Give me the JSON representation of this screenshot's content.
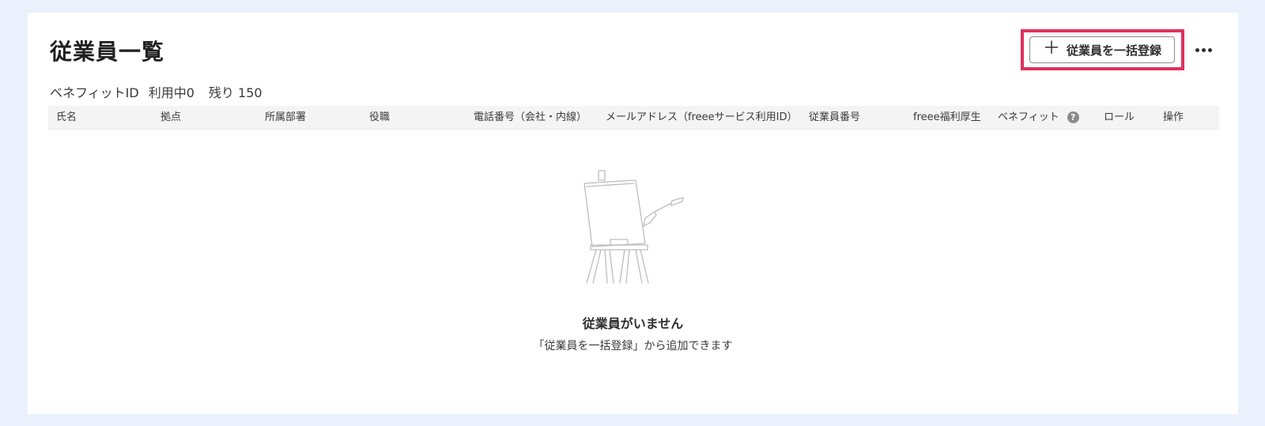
{
  "page": {
    "title": "従業員一覧"
  },
  "toolbar": {
    "bulk_register_label": "従業員を一括登録",
    "plus_icon": "plus-icon",
    "more_icon": "more-horizontal-icon",
    "highlight_color": "#e0305c"
  },
  "quota": {
    "label": "ベネフィットID",
    "in_use": "利用中0",
    "remaining": "残り 150"
  },
  "table": {
    "columns": [
      "氏名",
      "拠点",
      "所属部署",
      "役職",
      "電話番号（会社・内線）",
      "メールアドレス（freeeサービス利用ID）",
      "従業員番号",
      "freee福利厚生",
      "ベネフィット",
      "ロール",
      "操作"
    ],
    "help_icon_glyph": "?"
  },
  "empty_state": {
    "illustration": "easel-palette-illustration",
    "title": "従業員がいません",
    "subtitle": "「従業員を一括登録」から追加できます"
  }
}
